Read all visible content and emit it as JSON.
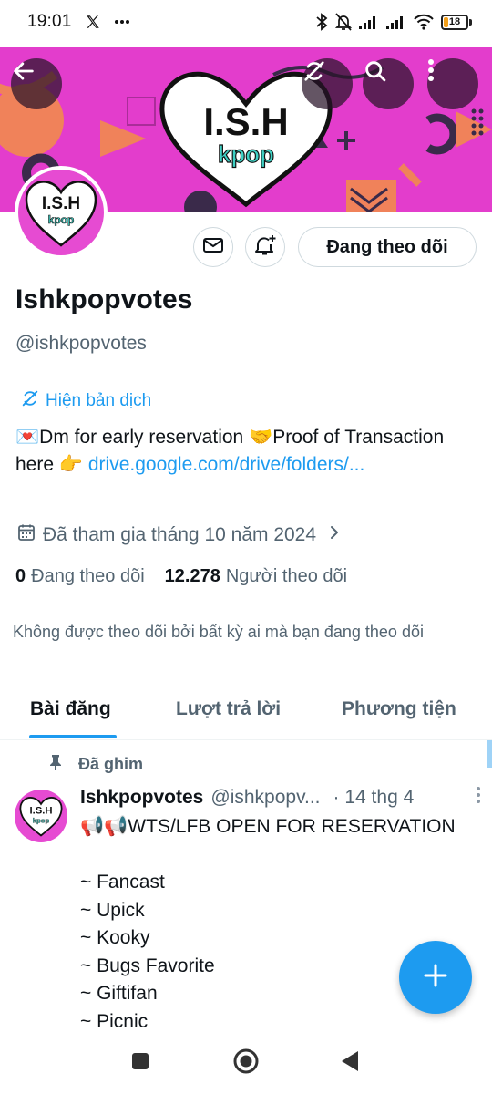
{
  "status_bar": {
    "time": "19:01",
    "battery": "18",
    "icons": [
      "x-logo-icon",
      "more-dots-icon",
      "bluetooth-icon",
      "bell-muted-icon",
      "signal-icon",
      "signal-icon",
      "wifi-icon",
      "battery-icon"
    ]
  },
  "banner": {
    "logo_text": "I.S.H",
    "logo_subtext": "kpop",
    "colors": {
      "background": "#e33dcc",
      "accent": "#f0825a"
    }
  },
  "profile": {
    "name": "Ishkpopvotes",
    "handle": "@ishkpopvotes",
    "follow_button": "Đang theo dõi",
    "translate_label": "Hiện bản dịch",
    "bio_text": "💌Dm for early reservation 🤝Proof of Transaction here 👉 ",
    "bio_link": "drive.google.com/drive/folders/...",
    "joined": "Đã tham gia tháng 10 năm 2024",
    "following_count": "0",
    "following_label": "Đang theo dõi",
    "followers_count": "12.278",
    "followers_label": "Người theo dõi",
    "not_followed_note": "Không được theo dõi bởi bất kỳ ai mà bạn đang theo dõi"
  },
  "tabs": [
    {
      "label": "Bài đăng",
      "active": true
    },
    {
      "label": "Lượt trả lời",
      "active": false
    },
    {
      "label": "Phương tiện",
      "active": false
    }
  ],
  "pinned_post": {
    "pinned_label": "Đã ghim",
    "author": "Ishkpopvotes",
    "handle": "@ishkpopv...",
    "time": "· 14 thg 4",
    "text": "📢📢WTS/LFB OPEN FOR RESERVATION\n\n~ Fancast\n~ Upick\n~ Kooky\n~ Bugs Favorite\n~ Giftifan\n~ Picnic"
  },
  "colors": {
    "accent": "#1d9bf0",
    "text": "#0f1419",
    "secondary_text": "#536471"
  }
}
